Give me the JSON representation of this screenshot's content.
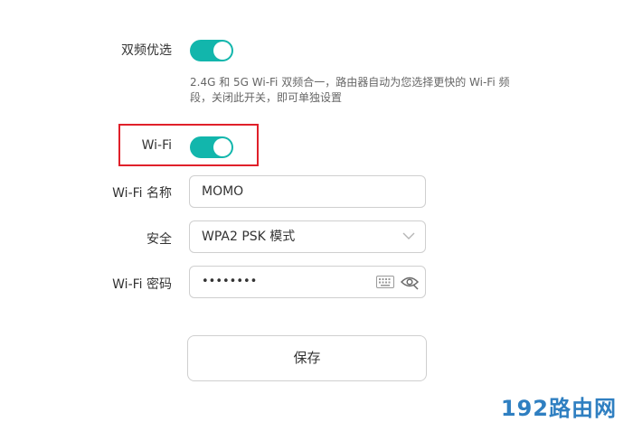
{
  "dual_band": {
    "label": "双频优选",
    "enabled": true,
    "hint": "2.4G 和 5G Wi-Fi 双频合一，路由器自动为您选择更快的 Wi-Fi 频段，关闭此开关，即可单独设置"
  },
  "wifi": {
    "label": "Wi-Fi",
    "enabled": true
  },
  "wifi_name": {
    "label": "Wi-Fi 名称",
    "value": "MOMO"
  },
  "security": {
    "label": "安全",
    "value": "WPA2 PSK 模式"
  },
  "wifi_password": {
    "label": "Wi-Fi 密码",
    "value": "••••••••"
  },
  "save_label": "保存",
  "watermark": "192路由网",
  "colors": {
    "toggle_on": "#12b6ac",
    "highlight": "#e0202a",
    "watermark": "#2f7fc1"
  }
}
